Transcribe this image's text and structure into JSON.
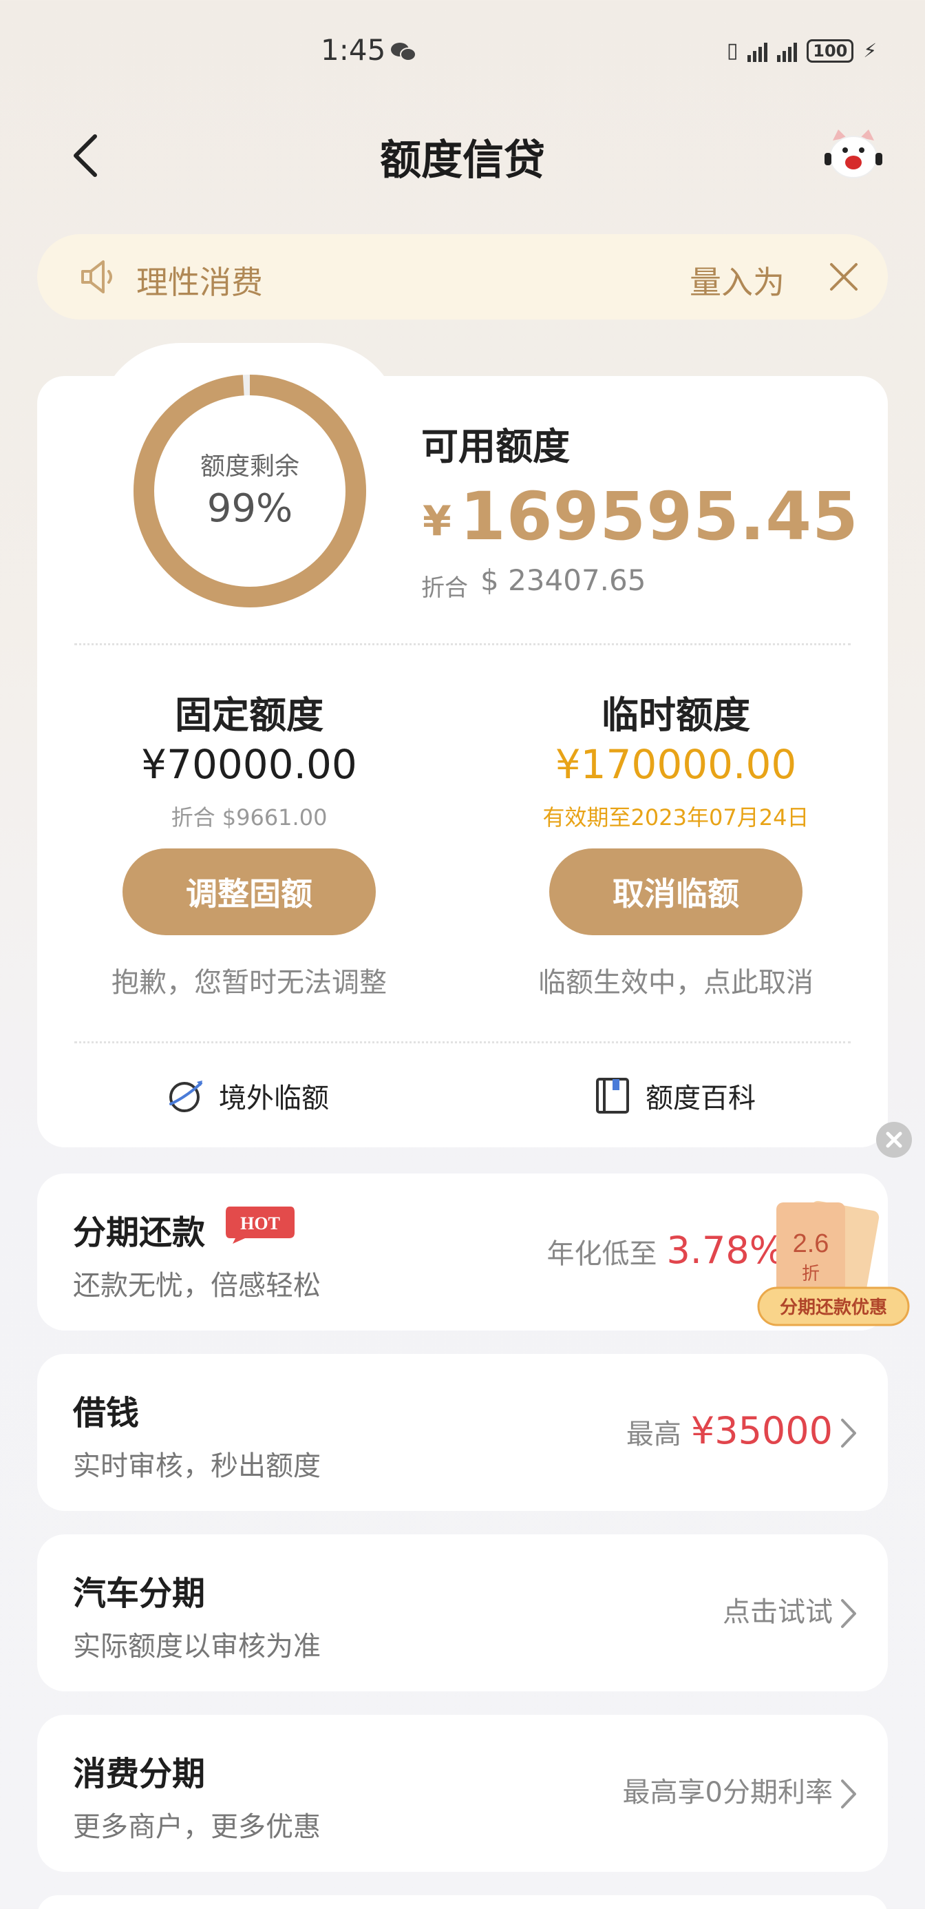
{
  "status_bar": {
    "time": "1:45",
    "battery": "100"
  },
  "header": {
    "title": "额度信贷"
  },
  "notice": {
    "text": "理性消费",
    "scroll_text": "量入为出"
  },
  "credit": {
    "ring_label": "额度剩余",
    "ring_percent": "99%",
    "ring_fraction": 0.99,
    "available_label": "可用额度",
    "currency_symbol": "¥",
    "available_amount": "169595.45",
    "equiv_label": "折合",
    "equiv_amount": "$ 23407.65"
  },
  "fixed": {
    "title": "固定额度",
    "amount": "¥70000.00",
    "equiv": "折合 $9661.00",
    "button": "调整固额",
    "note": "抱歉，您暂时无法调整"
  },
  "temp": {
    "title": "临时额度",
    "amount": "¥170000.00",
    "validity": "有效期至2023年07月24日",
    "button": "取消临额",
    "note": "临额生效中，点此取消"
  },
  "links": {
    "overseas": "境外临额",
    "encyclopedia": "额度百科"
  },
  "products": [
    {
      "title": "分期还款",
      "badge": "HOT",
      "sub": "还款无忧，倍感轻松",
      "right_label": "年化低至",
      "right_value": "3.78%"
    },
    {
      "title": "借钱",
      "sub": "实时审核，秒出额度",
      "right_label": "最高",
      "right_value": "¥35000"
    },
    {
      "title": "汽车分期",
      "sub": "实际额度以审核为准",
      "right_label": "点击试试"
    },
    {
      "title": "消费分期",
      "sub": "更多商户，更多优惠",
      "right_label": "最高享0分期利率"
    }
  ],
  "promo": {
    "discount": "2.6",
    "discount_unit": "折",
    "label": "分期还款优惠"
  },
  "colors": {
    "gold": "#c89d6a",
    "yellow": "#e8a317",
    "red": "#e1454c",
    "notice_bg": "#fbf4e4"
  }
}
